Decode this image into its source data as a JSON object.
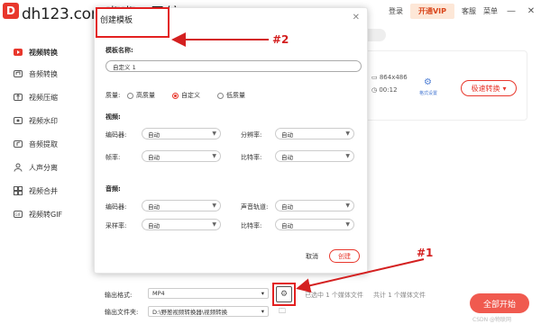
{
  "titlebar": {
    "logo": "D",
    "watermark": "dh123.com嘟嘟AI导航",
    "login": "登录",
    "vip": "开通VIP",
    "service": "客服",
    "menu": "菜单"
  },
  "sidebar": {
    "items": [
      {
        "label": "视频转换",
        "icon": "video-convert-icon",
        "active": true
      },
      {
        "label": "音频转换",
        "icon": "audio-convert-icon"
      },
      {
        "label": "视频压缩",
        "icon": "video-compress-icon"
      },
      {
        "label": "视频水印",
        "icon": "watermark-icon"
      },
      {
        "label": "音频提取",
        "icon": "audio-extract-icon"
      },
      {
        "label": "人声分离",
        "icon": "voice-separate-icon"
      },
      {
        "label": "视频合并",
        "icon": "video-merge-icon"
      },
      {
        "label": "视频转GIF",
        "icon": "gif-icon"
      }
    ]
  },
  "file_card": {
    "resolution": "864x486",
    "duration": "00:12",
    "template_label": "格式设置",
    "convert_button": "极速转换"
  },
  "dialog": {
    "title": "创建模板",
    "name_label": "模板名称:",
    "name_value": "自定义 1",
    "quality_label": "质量:",
    "quality_options": [
      "高质量",
      "自定义",
      "低质量"
    ],
    "quality_selected": 1,
    "video_section": "视频:",
    "encoder_label": "编码器:",
    "encoder_value": "自动",
    "resolution_label": "分辨率:",
    "resolution_value": "自动",
    "framerate_label": "帧率:",
    "framerate_value": "自动",
    "bitrate_label": "比特率:",
    "bitrate_value": "自动",
    "audio_section": "音频:",
    "a_encoder_label": "编码器:",
    "a_encoder_value": "自动",
    "channel_label": "声音轨道:",
    "channel_value": "自动",
    "samplerate_label": "采样率:",
    "samplerate_value": "自动",
    "a_bitrate_label": "比特率:",
    "a_bitrate_value": "自动",
    "cancel": "取消",
    "create": "创建"
  },
  "bottom": {
    "format_label": "输出格式:",
    "format_value": "MP4",
    "folder_label": "输出文件夹:",
    "folder_value": "D:\\野葱视频转换器\\视频转换",
    "selected_info": "已选中 1 个媒体文件",
    "total_info": "共计 1 个媒体文件",
    "start_button": "全部开始",
    "credit": "CSDN @物联网"
  },
  "annotations": {
    "label1": "#1",
    "label2": "#2",
    "color": "#d42020"
  }
}
